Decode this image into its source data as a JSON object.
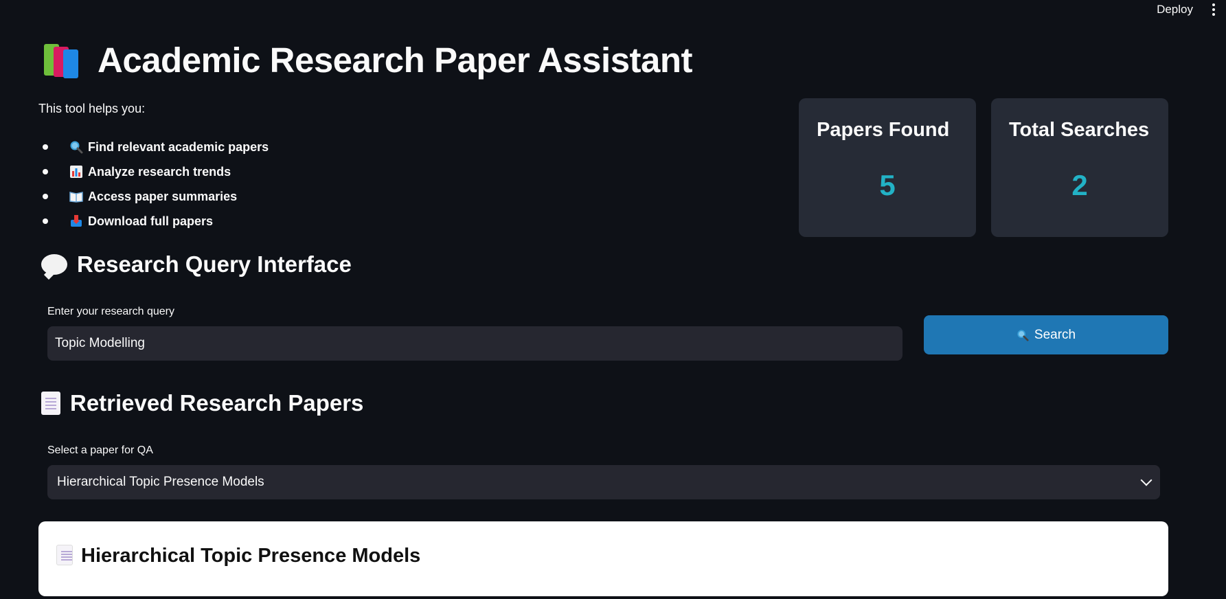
{
  "topbar": {
    "deploy_label": "Deploy"
  },
  "header": {
    "title": "Academic Research Paper Assistant",
    "icon": "books-icon"
  },
  "intro": {
    "text": "This tool helps you:",
    "features": [
      {
        "icon": "magnifier-icon",
        "label": "Find relevant academic papers"
      },
      {
        "icon": "bar-chart-icon",
        "label": "Analyze research trends"
      },
      {
        "icon": "open-book-icon",
        "label": "Access paper summaries"
      },
      {
        "icon": "inbox-icon",
        "label": "Download full papers"
      }
    ]
  },
  "metrics": [
    {
      "label": "Papers Found",
      "value": "5"
    },
    {
      "label": "Total Searches",
      "value": "2"
    }
  ],
  "query_section": {
    "heading": "Research Query Interface",
    "input_label": "Enter your research query",
    "input_value": "Topic Modelling",
    "search_label": "Search"
  },
  "papers_section": {
    "heading": "Retrieved Research Papers",
    "select_label": "Select a paper for QA",
    "selected_value": "Hierarchical Topic Presence Models"
  },
  "paper_card": {
    "title": "Hierarchical Topic Presence Models"
  },
  "colors": {
    "background": "#0e1117",
    "accent": "#1f77b4",
    "metric_value": "#22b2c6",
    "card": "#262b36"
  }
}
